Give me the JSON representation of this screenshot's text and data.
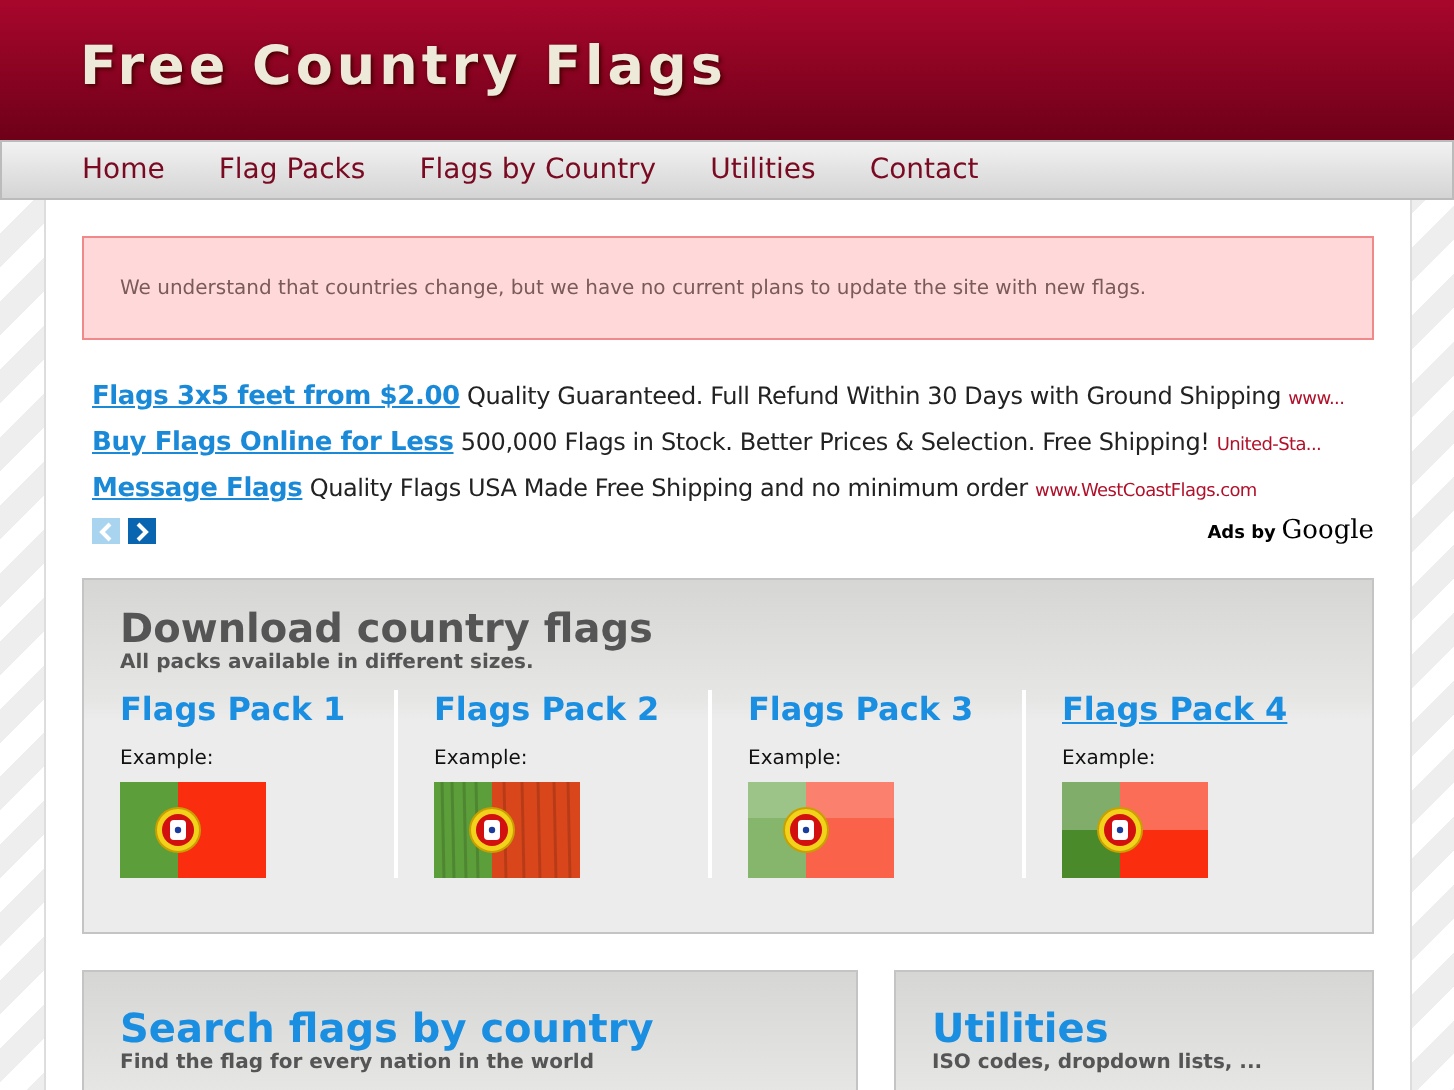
{
  "site_title": "Free Country Flags",
  "nav": [
    {
      "label": "Home"
    },
    {
      "label": "Flag Packs"
    },
    {
      "label": "Flags by Country"
    },
    {
      "label": "Utilities"
    },
    {
      "label": "Contact"
    }
  ],
  "notice": "We understand that countries change, but we have no current plans to update the site with new flags.",
  "ads": [
    {
      "title": "Flags 3x5 feet from $2.00",
      "text": "Quality Guaranteed. Full Refund Within 30 Days with Ground Shipping",
      "url": "www..."
    },
    {
      "title": "Buy Flags Online for Less",
      "text": "500,000 Flags in Stock. Better Prices & Selection. Free Shipping!",
      "url": "United-Sta..."
    },
    {
      "title": "Message Flags",
      "text": "Quality Flags USA Made Free Shipping and no minimum order",
      "url": "www.WestCoastFlags.com"
    }
  ],
  "ad_nav": {
    "prev_disabled": true,
    "next_disabled": false
  },
  "ads_by": "Ads by",
  "ads_brand": "Google",
  "download": {
    "title": "Download country flags",
    "subtitle": "All packs available in different sizes.",
    "packs": [
      {
        "title": "Flags Pack 1",
        "example": "Example:",
        "kind": "flat",
        "underlined": false
      },
      {
        "title": "Flags Pack 2",
        "example": "Example:",
        "kind": "wood",
        "underlined": false
      },
      {
        "title": "Flags Pack 3",
        "example": "Example:",
        "kind": "glossy",
        "underlined": false
      },
      {
        "title": "Flags Pack 4",
        "example": "Example:",
        "kind": "shine",
        "underlined": true
      }
    ]
  },
  "panels": [
    {
      "title": "Search flags by country",
      "subtitle": "Find the flag for every nation in the world"
    },
    {
      "title": "Utilities",
      "subtitle": "ISO codes, dropdown lists, ..."
    }
  ]
}
